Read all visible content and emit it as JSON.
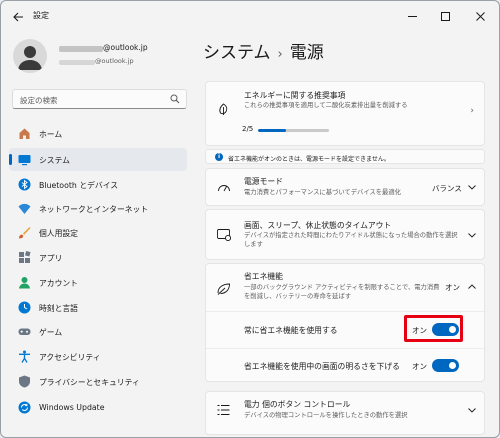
{
  "window": {
    "title": "設定"
  },
  "profile": {
    "email_primary": "@outlook.jp",
    "email_secondary": "@outlook.jp"
  },
  "search": {
    "placeholder": "設定の検索"
  },
  "sidebar": {
    "items": [
      {
        "label": "ホーム",
        "icon": "home-icon"
      },
      {
        "label": "システム",
        "icon": "system-icon",
        "selected": true
      },
      {
        "label": "Bluetooth とデバイス",
        "icon": "bluetooth-icon"
      },
      {
        "label": "ネットワークとインターネット",
        "icon": "network-icon"
      },
      {
        "label": "個人用設定",
        "icon": "brush-icon"
      },
      {
        "label": "アプリ",
        "icon": "apps-icon"
      },
      {
        "label": "アカウント",
        "icon": "account-icon"
      },
      {
        "label": "時刻と言語",
        "icon": "time-language-icon"
      },
      {
        "label": "ゲーム",
        "icon": "gaming-icon"
      },
      {
        "label": "アクセシビリティ",
        "icon": "accessibility-icon"
      },
      {
        "label": "プライバシーとセキュリティ",
        "icon": "shield-icon"
      },
      {
        "label": "Windows Update",
        "icon": "update-icon"
      }
    ]
  },
  "breadcrumb": {
    "parent": "システム",
    "separator": "›",
    "current": "電源"
  },
  "energy_card": {
    "title": "エネルギーに関する推奨事項",
    "subtitle": "これらの推奨事項を適用して二酸化炭素排出量を削減する",
    "progress_label": "2/5",
    "progress": 0.4
  },
  "info_bar": {
    "text": "省エネ機能がオンのときは、電源モードを設定できません。"
  },
  "power_mode": {
    "title": "電源モード",
    "subtitle": "電力消費とパフォーマンスに基づいてデバイスを最適化",
    "value": "バランス"
  },
  "screen_sleep": {
    "title": "画面、スリープ、休止状態のタイムアウト",
    "subtitle_line1": "デバイスが指定された時間にわたりアイドル状態になった場合の動作を選択",
    "subtitle_line2": "します"
  },
  "energy_saver": {
    "title": "省エネ機能",
    "subtitle_line1": "一部のバックグラウンド アクティビティを制限することで、電力消費",
    "subtitle_line2": "を削減し、バッテリーの寿命を延ばす",
    "value": "オン",
    "always_label": "常に省エネ機能を使用する",
    "always_value": "オン",
    "always_on": true,
    "brightness_label": "省エネ機能を使用中の画面の明るさを下げる",
    "brightness_value": "オン",
    "brightness_on": true
  },
  "power_button": {
    "title": "電力 個のボタン コントロール",
    "subtitle": "デバイスの物理コントロールを操作したときの動作を選択"
  },
  "colors": {
    "accent": "#0067c0",
    "highlight": "#e60012"
  }
}
